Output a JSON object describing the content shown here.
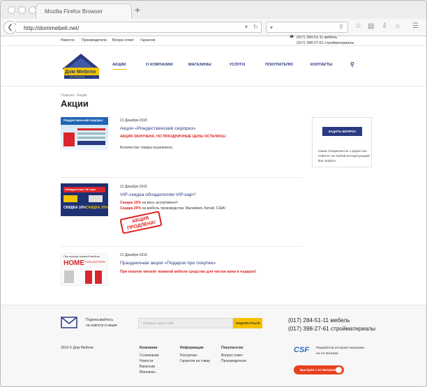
{
  "browser": {
    "tab_title": "Mozilla Firefox Browser",
    "new_tab": "+",
    "url": "http://dommebeli.net/",
    "search_placeholder": "",
    "icons": [
      "back-arrow-icon",
      "dropdown-icon",
      "reload-icon",
      "search-icon",
      "bookmark-star-icon",
      "reader-icon",
      "download-icon",
      "home-icon",
      "menu-icon"
    ]
  },
  "utility_nav": {
    "links": [
      "Новости",
      "Производители",
      "Вопрос-ответ",
      "Гарантия"
    ],
    "phone1": "(017) 284-51-11 мебель",
    "phone2": "(017) 398-27-61 стройматериалы"
  },
  "logo": {
    "name": "Дом Мебели",
    "tagline": "сеть магазинов",
    "colors": {
      "roof": "#2a3a80",
      "band": "#f2c400"
    }
  },
  "main_nav": [
    "АКЦИИ",
    "О КОМПАНИИ",
    "МАГАЗИНЫ",
    "УСЛУГИ",
    "ПОКУПАТЕЛЮ",
    "КОНТАКТЫ"
  ],
  "breadcrumb": {
    "home": "Главная",
    "sep": "›",
    "current": "Акции"
  },
  "page_title": "Акции",
  "promos": [
    {
      "date": "21 Декабря 2015",
      "title": "Акция «Рождественский сюрприз»",
      "red_line": "АКЦИЯ ОКОНЧЕНА, НО ПРАЗДНИЧНЫЕ ЦЕНЫ ОСТАЛИСЬ!",
      "text": "Количество товара ограничено.",
      "image_text": "Рождественский сюрприз"
    },
    {
      "date": "21 Декабря 2015",
      "title": "VIP-скидка обладателям VIP-карт!",
      "discount1": "Скидка 10%",
      "discount1_rest": " на весь ассортимент!",
      "discount2": "Скидка 20%",
      "discount2_rest": " на мебель производства: Малайзия, Китай, США!",
      "image_top": "Обладателям VIP-карт",
      "image_left": "СКИДКА 10%",
      "image_right": "СКИДКА 20%",
      "stamp_line1": "АКЦИЯ",
      "stamp_line2": "ПРОДЛЕНА!"
    },
    {
      "date": "21 Декабря 2015",
      "title": "Праздничная акция «Подарок при покупке»",
      "red_line": "При покупке мягкой- кожаной мебели средство для чистки кожи в подарок!",
      "image_top": "При покупке кожаной мебели",
      "image_home": "HOME",
      "image_collection": "COLLECTION"
    }
  ],
  "question_box": {
    "button": "ЗАДАТЬ ВОПРОС",
    "text": "Наши специалисты с радостью ответят на любой интересующий Вас вопрос."
  },
  "footer": {
    "subscribe_text1": "Подписывайтесь",
    "subscribe_text2": "на новости и акции",
    "email_placeholder": "Оставьте свой e-mail",
    "subscribe_button": "ПОДПИСАТЬСЯ",
    "phone1": "(017) 284-51-11 мебель",
    "phone2": "(017) 398-27-61 стройматериалы",
    "copyright": "2016 © Дом Мебели",
    "col1_title": "Компания",
    "col1_links": [
      "О компании",
      "Новости",
      "Вакансии",
      "Магазины"
    ],
    "col2_title": "Информация",
    "col2_links": [
      "Рассрочка",
      "Гарантия на товар"
    ],
    "col3_title": "Покупателю",
    "col3_links": [
      "Вопрос-ответ",
      "Производители"
    ],
    "dev_logo": "CSF",
    "dev_text1": "Разработка интернет-магазина",
    "dev_text2": "на 1С-Битрикс",
    "bitrix_badge": "Быстрее с 1С-Битрикс"
  }
}
